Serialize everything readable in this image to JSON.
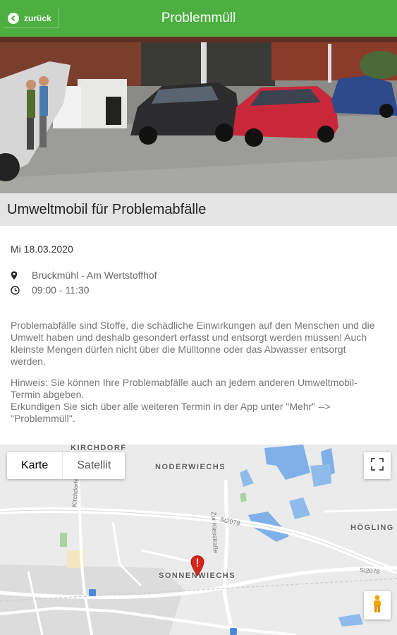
{
  "header": {
    "back_label": "zurück",
    "title": "Problemmüll",
    "color": "#4caf3f"
  },
  "event": {
    "title": "Umweltmobil für Problemabfälle",
    "date": "Mi 18.03.2020",
    "location": "Bruckmühl - Am Wertstoffhof",
    "time": "09:00 - 11:30",
    "description_1": "Problemabfälle sind Stoffe, die schädliche Einwirkungen auf den Menschen und die Umwelt haben und deshalb gesondert erfasst und entsorgt werden müssen! Auch kleinste Mengen dürfen nicht über die Mülltonne oder das Abwasser entsorgt werden.",
    "description_2": "Hinweis: Sie können Ihre Problemabfälle auch an jedem anderen Umweltmobil-Termin abgeben.\nErkundigen Sie sich über alle weiteren Termin in der App unter \"Mehr\" --> \"Problemmüll\"."
  },
  "map": {
    "type_options": [
      "Karte",
      "Satellit"
    ],
    "selected_type": "Karte",
    "places": {
      "kirchdorf": "KIRCHDORF",
      "noderwiechs": "NODERWIECHS",
      "hoegling": "HÖGLING",
      "sonnenwiechs": "SONNENWIECHS"
    },
    "roads": {
      "kirchdorfer": "Kirchdorfer Str.",
      "kreisstr": "Zur Kiesstraße",
      "st2078a": "St2078",
      "st2078b": "St2078"
    },
    "icons": {
      "back": "chevron-left-icon",
      "location": "location-pin-icon",
      "time": "clock-icon",
      "fullscreen": "fullscreen-icon",
      "pegman": "pegman-icon",
      "marker": "map-marker-icon"
    }
  }
}
